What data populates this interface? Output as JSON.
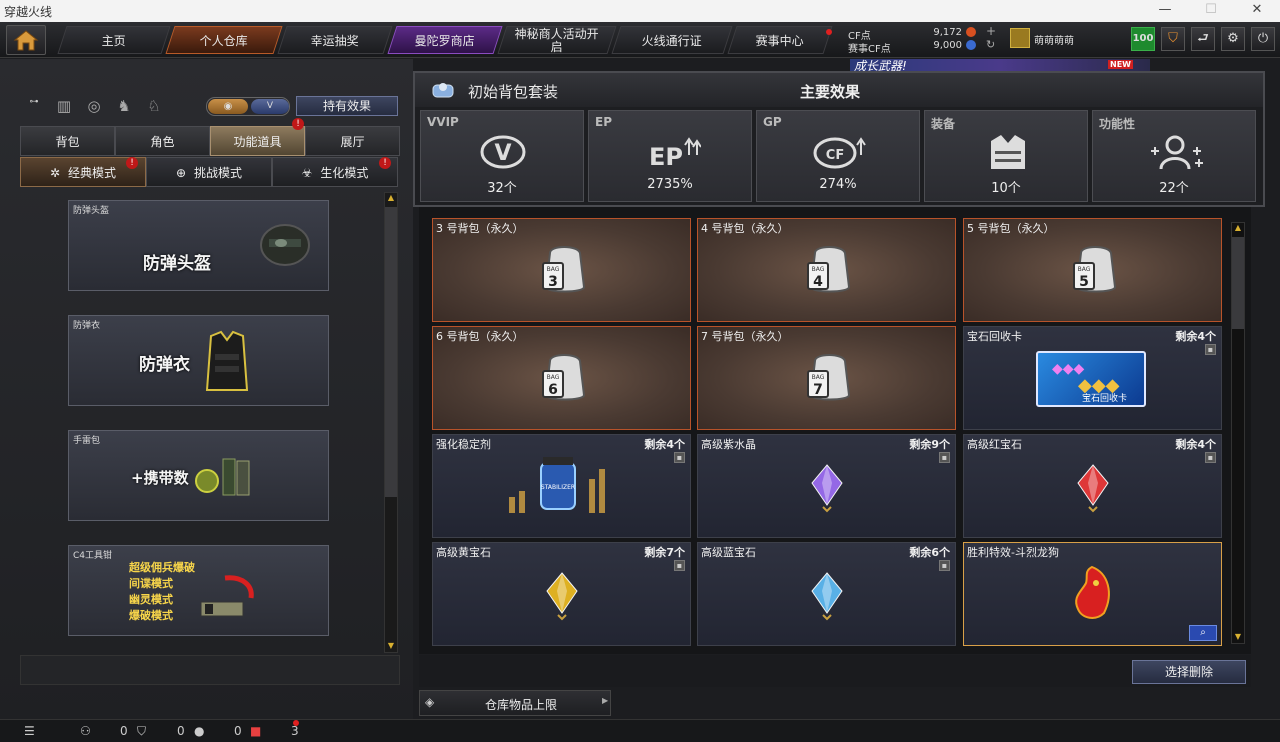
{
  "window": {
    "title": "穿越火线"
  },
  "nav": {
    "tabs": [
      "主页",
      "个人仓库",
      "幸运抽奖",
      "曼陀罗商店",
      "神秘商人活动开启",
      "火线通行证",
      "赛事中心"
    ],
    "active_tab": "个人仓库",
    "cf_label": "CF点",
    "cf_value": "9,172",
    "match_cf_label": "赛事CF点",
    "match_cf_value": "9,000",
    "username": "萌萌萌萌",
    "level": "100",
    "banner_text": "成长武器!",
    "banner_badge": "NEW"
  },
  "left": {
    "effect_button": "持有效果",
    "sub_tabs": [
      "背包",
      "角色",
      "功能道具",
      "展厅"
    ],
    "active_sub_tab": "功能道具",
    "modes": [
      "经典模式",
      "挑战模式",
      "生化模式"
    ],
    "active_mode": "经典模式",
    "cards": [
      {
        "label": "防弹头盔",
        "title": "防弹头盔"
      },
      {
        "label": "防弹衣",
        "title": "防弹衣"
      },
      {
        "label": "手雷包",
        "title": "+携带数"
      },
      {
        "label": "C4工具钳",
        "lines": [
          "超级佣兵爆破",
          "间谍模式",
          "幽灵模式",
          "爆破模式"
        ]
      }
    ]
  },
  "popup": {
    "title": "初始背包套装",
    "subtitle": "主要效果",
    "stats": [
      {
        "name": "VVIP",
        "value": "32个",
        "icon": "vvip-icon"
      },
      {
        "name": "EP",
        "value": "2735%",
        "icon": "ep-up-icon"
      },
      {
        "name": "GP",
        "value": "274%",
        "icon": "gp-up-icon"
      },
      {
        "name": "装备",
        "value": "10个",
        "icon": "armor-icon"
      },
      {
        "name": "功能性",
        "value": "22个",
        "icon": "team-plus-icon"
      }
    ]
  },
  "items": [
    {
      "name": "3 号背包（永久）",
      "count": "",
      "kind": "bag",
      "bag_no": "3"
    },
    {
      "name": "4 号背包（永久）",
      "count": "",
      "kind": "bag",
      "bag_no": "4"
    },
    {
      "name": "5 号背包（永久）",
      "count": "",
      "kind": "bag",
      "bag_no": "5"
    },
    {
      "name": "6 号背包（永久）",
      "count": "",
      "kind": "bag",
      "bag_no": "6"
    },
    {
      "name": "7 号背包（永久）",
      "count": "",
      "kind": "bag",
      "bag_no": "7"
    },
    {
      "name": "宝石回收卡",
      "count": "剩余4个",
      "kind": "card",
      "card_text": "宝石回收卡"
    },
    {
      "name": "强化稳定剂",
      "count": "剩余4个",
      "kind": "stabilizer",
      "jar_text": "STABILIZER"
    },
    {
      "name": "高级紫水晶",
      "count": "剩余9个",
      "kind": "gem",
      "color": "#9a6cf0"
    },
    {
      "name": "高级红宝石",
      "count": "剩余4个",
      "kind": "gem",
      "color": "#e83838"
    },
    {
      "name": "高级黄宝石",
      "count": "剩余7个",
      "kind": "gem",
      "color": "#e8b820"
    },
    {
      "name": "高级蓝宝石",
      "count": "剩余6个",
      "kind": "gem",
      "color": "#5cb8f0"
    },
    {
      "name": "胜利特效-斗烈龙狗",
      "count": "",
      "kind": "effect"
    }
  ],
  "bottom": {
    "delete_button": "选择删除",
    "storage_limit": "仓库物品上限"
  },
  "status": {
    "friends": "0",
    "shield": "0",
    "chat": "0",
    "gift": "3"
  }
}
